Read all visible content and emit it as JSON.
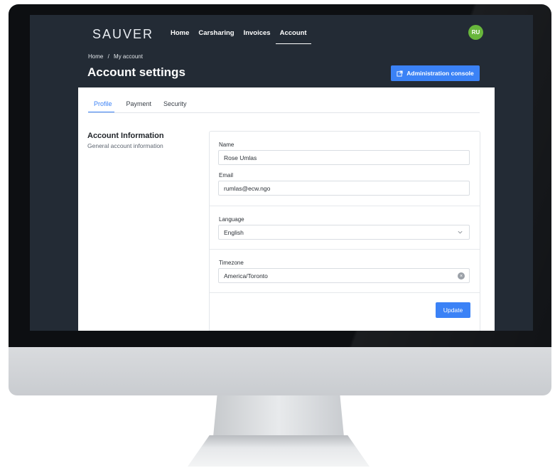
{
  "app": {
    "logo": "SAUVER"
  },
  "nav": {
    "items": [
      "Home",
      "Carsharing",
      "Invoices",
      "Account"
    ]
  },
  "user": {
    "initials": "RU"
  },
  "breadcrumb": {
    "home": "Home",
    "sep": "/",
    "current": "My account"
  },
  "page": {
    "title": "Account settings",
    "admin_button": "Administration console"
  },
  "tabs": [
    "Profile",
    "Payment",
    "Security"
  ],
  "section": {
    "title": "Account Information",
    "subtitle": "General account information"
  },
  "form": {
    "name_label": "Name",
    "name_value": "Rose Umlas",
    "email_label": "Email",
    "email_value": "rumlas@ecw.ngo",
    "language_label": "Language",
    "language_value": "English",
    "timezone_label": "Timezone",
    "timezone_value": "America/Toronto",
    "update_button": "Update"
  },
  "colors": {
    "accent": "#3b82f6",
    "header_bg": "#232b35",
    "avatar": "#68b63c"
  },
  "icons": [
    "external-link-icon",
    "chevron-down-icon",
    "clear-icon"
  ]
}
